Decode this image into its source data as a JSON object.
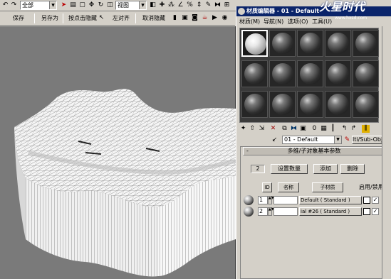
{
  "toolbar": {
    "selection_filter": "全部",
    "view_dropdown": "视图"
  },
  "toolbar2": {
    "save": "保存",
    "save_as": "另存为",
    "hide_by_click": "按点击隐藏",
    "align_left": "左对齐",
    "unhide": "取消隐藏"
  },
  "material_editor": {
    "title": "材质编辑器 - 01 - Default",
    "menus": [
      "材质(M)",
      "导航(N)",
      "选项(O)",
      "工具(U)"
    ],
    "material_name": "01 - Default",
    "material_type": "lti/Sub-Object",
    "slots_count": 15,
    "active_slot": 0,
    "rollout": {
      "title": "多维/子对象基本参数",
      "toggle": "-",
      "count": "2",
      "set_number": "设置数量",
      "add": "添加",
      "delete": "删除",
      "col_id": "ID",
      "col_name": "名称",
      "col_submat": "子材质",
      "col_onoff": "启用/禁用",
      "rows": [
        {
          "id": "1",
          "name": "",
          "submaterial": "Default  ( Standard )",
          "enabled": true
        },
        {
          "id": "2",
          "name": "",
          "submaterial": "ial #26  ( Standard )",
          "enabled": true
        }
      ]
    }
  },
  "watermark": {
    "text": "火星时代",
    "url": "www.hxsd.com"
  },
  "icons": [
    "arrow-cursor-icon",
    "move-icon",
    "rotate-icon",
    "scale-icon",
    "snap-icon",
    "angle-snap-icon",
    "mirror-icon",
    "align-icon",
    "render-icon",
    "teapot-icon"
  ]
}
